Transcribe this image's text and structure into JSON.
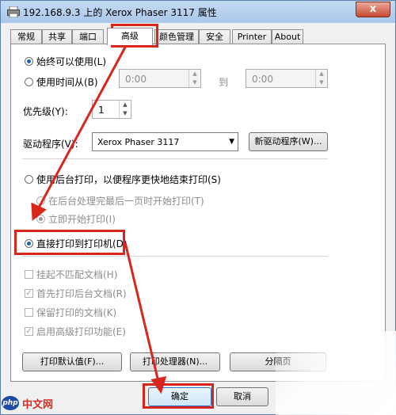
{
  "title": "192.168.9.3 上的 Xerox Phaser 3117 属性",
  "close_glyph": "x",
  "tabs": [
    {
      "label": "常规"
    },
    {
      "label": "共享"
    },
    {
      "label": "端口"
    },
    {
      "label": "高级"
    },
    {
      "label": "颜色管理"
    },
    {
      "label": "安全"
    },
    {
      "label": "Printer"
    },
    {
      "label": "About"
    }
  ],
  "availability": {
    "always_label": "始终可以使用(L)",
    "from_label": "使用时间从(B)",
    "from_time": "0:00",
    "to_label": "到",
    "to_time": "0:00"
  },
  "priority": {
    "label": "优先级(Y):",
    "value": "1"
  },
  "driver": {
    "label": "驱动程序(V):",
    "value": "Xerox Phaser 3117",
    "new_button": "新驱动程序(W)..."
  },
  "spool": {
    "spool_label": "使用后台打印，以便程序更快地结束打印(S)",
    "after_last_page": "在后台处理完最后一页时开始打印(T)",
    "immediately": "立即开始打印(I)",
    "direct_label": "直接打印到打印机(D)"
  },
  "options": [
    {
      "label": "挂起不匹配文档(H)",
      "checked": false
    },
    {
      "label": "首先打印后台文档(R)",
      "checked": true
    },
    {
      "label": "保留打印的文档(K)",
      "checked": false
    },
    {
      "label": "启用高级打印功能(E)",
      "checked": true
    }
  ],
  "bottom_buttons": {
    "defaults": "打印默认值(F)...",
    "processor": "打印处理器(N)...",
    "separator": "分隔页"
  },
  "footer": {
    "ok": "确定",
    "cancel": "取消"
  },
  "watermark": {
    "logo": "php",
    "text": "中文网"
  },
  "accent_red": "#d9261c"
}
